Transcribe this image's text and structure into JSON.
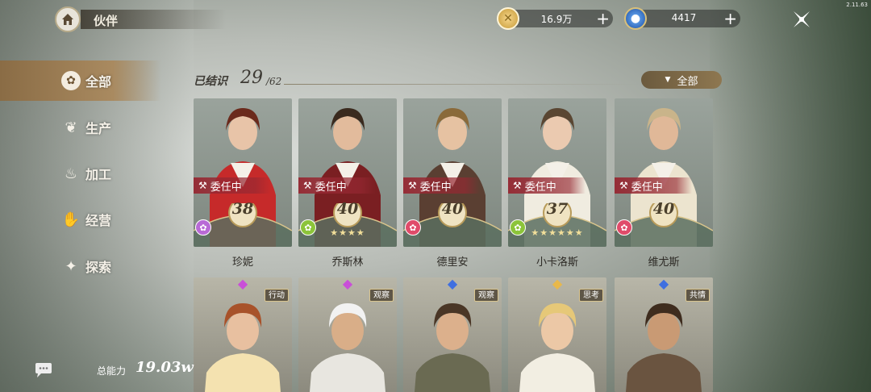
{
  "version": "2.11.63",
  "header": {
    "title": "伙伴"
  },
  "currencies": [
    {
      "icon": "gold-coin-icon",
      "value": "16.9万"
    },
    {
      "icon": "blue-gem-icon",
      "value": "4417"
    }
  ],
  "sidebar": {
    "items": [
      {
        "label": "全部",
        "icon": "grid-icon",
        "active": true
      },
      {
        "label": "生产",
        "icon": "leaf-icon",
        "active": false
      },
      {
        "label": "加工",
        "icon": "pot-icon",
        "active": false
      },
      {
        "label": "经营",
        "icon": "hand-icon",
        "active": false
      },
      {
        "label": "探索",
        "icon": "compass-icon",
        "active": false
      }
    ]
  },
  "known": {
    "label": "已结识",
    "count": "29",
    "total": "/62"
  },
  "filter": {
    "label": "全部"
  },
  "cards_top": [
    {
      "name": "珍妮",
      "level": "38",
      "badge": "委任中",
      "badge_icon": "pick-icon",
      "stars": "",
      "type_color": "#b86ad6"
    },
    {
      "name": "乔斯林",
      "level": "40",
      "badge": "委任中",
      "badge_icon": "rooster-icon",
      "stars": "★★★★",
      "type_color": "#8cc43a"
    },
    {
      "name": "德里安",
      "level": "40",
      "badge": "委任中",
      "badge_icon": "anvil-icon",
      "stars": "",
      "type_color": "#e04b6a"
    },
    {
      "name": "小卡洛斯",
      "level": "37",
      "badge": "委任中",
      "badge_icon": "rooster-icon",
      "stars": "★★★★★★",
      "type_color": "#8cc43a"
    },
    {
      "name": "维尤斯",
      "level": "40",
      "badge": "委任中",
      "badge_icon": "books-icon",
      "stars": "",
      "type_color": "#e04b6a"
    }
  ],
  "cards_bottom": [
    {
      "tag": "行动",
      "gem_color": "#c94fd8"
    },
    {
      "tag": "观察",
      "gem_color": "#c94fd8"
    },
    {
      "tag": "观察",
      "gem_color": "#3f6fe0"
    },
    {
      "tag": "思考",
      "gem_color": "#e8b84a"
    },
    {
      "tag": "共情",
      "gem_color": "#3f6fe0"
    }
  ],
  "footer": {
    "power_label": "总能力",
    "power_value": "19.03w"
  }
}
